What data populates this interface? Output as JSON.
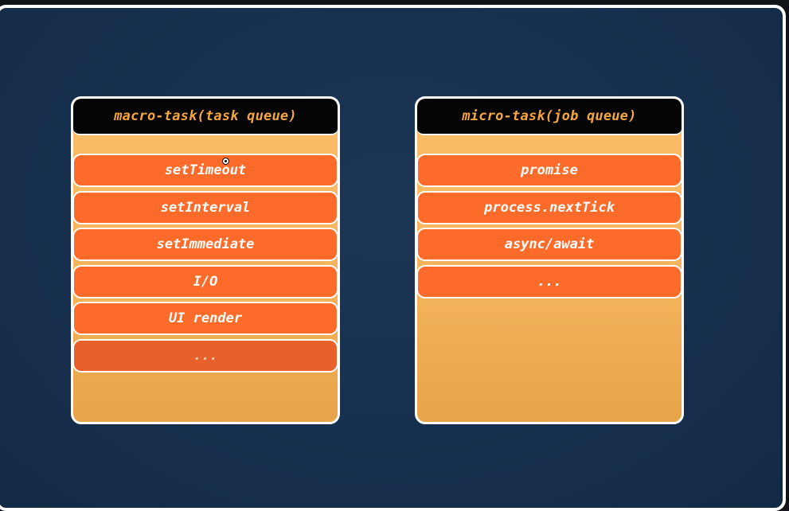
{
  "macro_queue": {
    "title": "macro-task(task queue)",
    "items": [
      "setTimeout",
      "setInterval",
      "setImmediate",
      "I/O",
      "UI render",
      "..."
    ]
  },
  "micro_queue": {
    "title": "micro-task(job queue)",
    "items": [
      "promise",
      "process.nextTick",
      "async/await",
      "..."
    ]
  },
  "colors": {
    "background": "#17304f",
    "queue_body": "#f3b35a",
    "item": "#fc6b2a",
    "header_bg": "#050505",
    "header_text": "#f6a63e"
  }
}
